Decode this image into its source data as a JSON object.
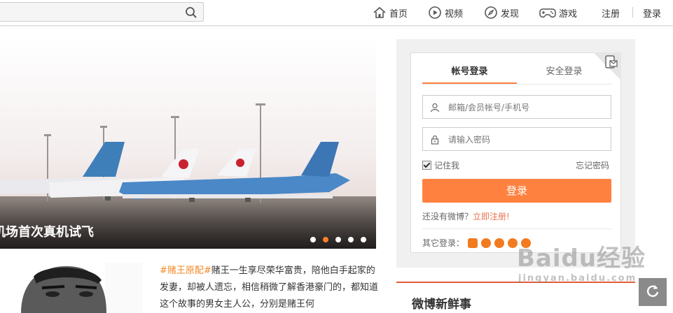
{
  "search": {
    "value": "",
    "placeholder": ""
  },
  "nav": {
    "home": "首页",
    "video": "视频",
    "discover": "发现",
    "games": "游戏",
    "register": "注册",
    "login": "登录"
  },
  "hero": {
    "caption": "机场首次真机试飞",
    "dots": 5,
    "active_dot": 2
  },
  "article": {
    "tag": "#赌王原配#",
    "text": "赌王一生享尽荣华富贵，陪他白手起家的发妻，却被人遗忘，相信稍微了解香港豪门的，都知道这个故事的男女主人公，分别是赌王何"
  },
  "login_box": {
    "tab_account": "帐号登录",
    "tab_secure": "安全登录",
    "username_placeholder": "邮箱/会员帐号/手机号",
    "password_placeholder": "请输入密码",
    "remember": "记住我",
    "forgot": "忘记密码",
    "submit": "登录",
    "no_account": "还没有微博？",
    "register_now": "立即注册!",
    "other_login": "其它登录："
  },
  "section": {
    "fresh_title": "微博新鲜事"
  },
  "watermark": {
    "main": "Baidu经验",
    "sub": "jingyan.baidu.com"
  },
  "colors": {
    "accent": "#ff8140",
    "link": "#eb7350",
    "tag": "#f28a2a",
    "active_dot": "#ff7f2a"
  }
}
